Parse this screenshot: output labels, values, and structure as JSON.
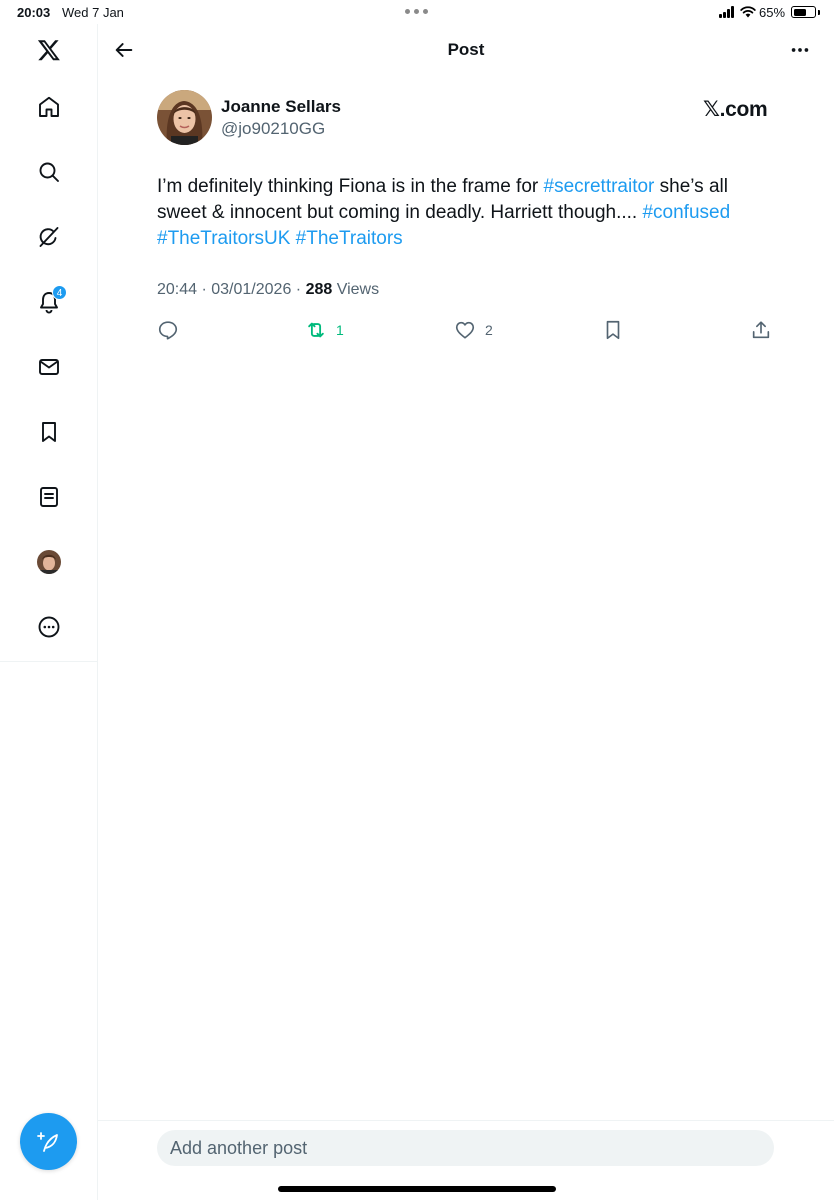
{
  "status_bar": {
    "time": "20:03",
    "date": "Wed 7 Jan",
    "battery_percent": "65%",
    "battery_level": 0.65
  },
  "sidebar": {
    "items": [
      {
        "name": "x-logo",
        "icon": "x-logo-icon"
      },
      {
        "name": "home",
        "icon": "home-icon"
      },
      {
        "name": "search",
        "icon": "search-icon"
      },
      {
        "name": "grok",
        "icon": "grok-icon"
      },
      {
        "name": "notifications",
        "icon": "bell-icon",
        "badge": "4"
      },
      {
        "name": "messages",
        "icon": "envelope-icon"
      },
      {
        "name": "bookmarks",
        "icon": "bookmark-icon"
      },
      {
        "name": "lists",
        "icon": "list-icon"
      },
      {
        "name": "profile",
        "icon": "avatar"
      },
      {
        "name": "more",
        "icon": "more-circle-icon"
      }
    ],
    "compose_icon": "compose-feather-icon"
  },
  "header": {
    "title": "Post",
    "back_icon": "back-arrow-icon",
    "more_icon": "more-horizontal-icon"
  },
  "post": {
    "author_name": "Joanne Sellars",
    "author_handle": "@jo90210GG",
    "source_logo": "𝕏.com",
    "text_segments": [
      {
        "text": "I’m definitely thinking Fiona is in the frame for ",
        "type": "text"
      },
      {
        "text": "#secrettraitor",
        "type": "hashtag"
      },
      {
        "text": " she’s all sweet & innocent but coming in deadly. Harriett though.... ",
        "type": "text"
      },
      {
        "text": "#confused",
        "type": "hashtag"
      },
      {
        "text": " ",
        "type": "text"
      },
      {
        "text": "#TheTraitorsUK",
        "type": "hashtag"
      },
      {
        "text": " ",
        "type": "text"
      },
      {
        "text": "#TheTraitors",
        "type": "hashtag"
      }
    ],
    "timestamp": "20:44 · 03/01/2026 · ",
    "views_count": "288",
    "views_label": " Views",
    "actions": {
      "reply": {
        "icon": "reply-icon",
        "count": ""
      },
      "retweet": {
        "icon": "retweet-icon",
        "count": "1",
        "active_color": "#00ba7c"
      },
      "like": {
        "icon": "heart-icon",
        "count": "2"
      },
      "bookmark": {
        "icon": "bookmark-icon",
        "count": ""
      },
      "share": {
        "icon": "share-icon",
        "count": ""
      }
    }
  },
  "reply_bar": {
    "placeholder": "Add another post"
  },
  "colors": {
    "accent": "#1d9bf0",
    "text": "#0f1419",
    "secondary_text": "#536471",
    "retweet_green": "#00ba7c"
  }
}
